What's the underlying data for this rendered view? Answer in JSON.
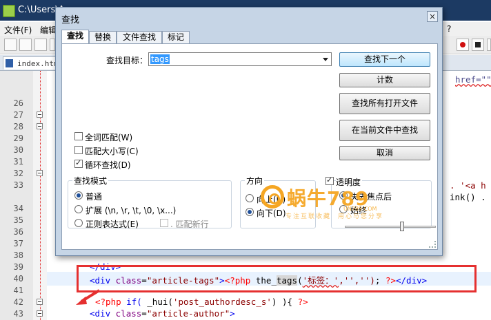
{
  "window": {
    "title": "C:\\Users\\A"
  },
  "menu": [
    {
      "label": "文件(F)"
    },
    {
      "label": "编辑"
    },
    {
      "label": "?"
    }
  ],
  "file_tab": {
    "label": "index.htm"
  },
  "line_numbers": [
    "26",
    "27",
    "28",
    "29",
    "30",
    "31",
    "32",
    "33",
    "34",
    "35",
    "36",
    "37",
    "38",
    "39",
    "40",
    "41",
    "42",
    "43"
  ],
  "code": {
    "l25_right": "href=\"\"",
    "l33_right": ". '<a h",
    "l34_right": "ink() .",
    "l39": "</div>",
    "l40": {
      "indent": "  ",
      "open": "<div",
      "attr": "class",
      "val": "\"article-tags\"",
      "close": ">",
      "php_open": "<?php",
      "fn_pre": "the_",
      "fn_hit": "tags",
      "arg_open": "(",
      "arg": "'标签：'",
      "args_rest": ",'','')",
      "semi": ";",
      "php_close": "?>",
      "end": "</div>"
    },
    "l42": {
      "php_open": "<?php",
      "kw": "if(",
      "fn": "_hui(",
      "arg": "'post_authordesc_s'",
      "rest": ") ){",
      "php_close": "?>"
    },
    "l43": {
      "open": "<div",
      "attr": "class",
      "val": "\"article-author\"",
      "close": ">"
    }
  },
  "dialog": {
    "title": "查找",
    "close_glyph": "×",
    "tabs": [
      {
        "label": "查找",
        "active": true
      },
      {
        "label": "替换"
      },
      {
        "label": "文件查找"
      },
      {
        "label": "标记"
      }
    ],
    "search_label": "查找目标：",
    "search_value": "tags",
    "buttons": {
      "find_next": "查找下一个",
      "count": "计数",
      "find_all_open": "查找所有打开文件",
      "find_in_current": "在当前文件中查找",
      "cancel": "取消"
    },
    "options": {
      "whole_word": {
        "label": "全词匹配(W)",
        "checked": false
      },
      "match_case": {
        "label": "匹配大小写(C)",
        "checked": false
      },
      "wrap": {
        "label": "循环查找(D)",
        "checked": true
      }
    },
    "mode": {
      "title": "查找模式",
      "normal": "普通",
      "extended": "扩展 (\\n, \\r, \\t, \\0, \\x...)",
      "regex": "正则表达式(E)",
      "dot_newline": ". 匹配新行",
      "selected": "normal"
    },
    "direction": {
      "title": "方向",
      "up": "向上(U)",
      "down": "向下(D)",
      "selected": "down"
    },
    "transparency": {
      "label": "透明度",
      "checked": true,
      "on_lose_focus": "失去焦点后",
      "always": "始终",
      "selected": "on_lose_focus",
      "level": 0.6
    }
  },
  "watermark": {
    "logo": "蜗牛789",
    "site": "UN789.COM",
    "tagline_left": "专注互联收藏",
    "tagline_right": "用心与您分享"
  },
  "colors": {
    "title_bar": "#1c3a63",
    "dialog_bg": "#c6d5e6",
    "highlight_box": "#e53030",
    "html_tag": "#0000ee",
    "html_attr": "#800080",
    "string": "#8b0000",
    "php_tag": "#ff0000",
    "selection": "#3399ff",
    "watermark": "#f5a623"
  }
}
